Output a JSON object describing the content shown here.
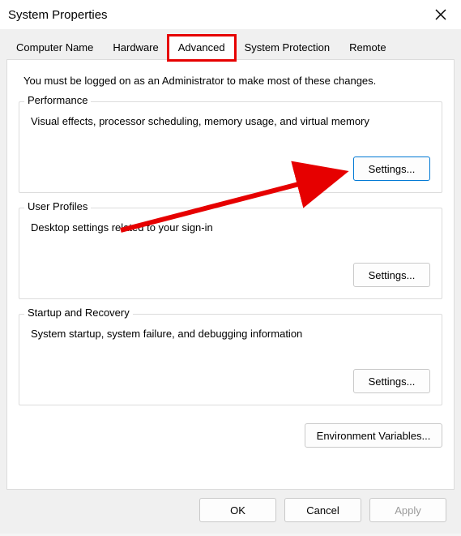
{
  "window": {
    "title": "System Properties"
  },
  "tabs": {
    "items": [
      {
        "label": "Computer Name"
      },
      {
        "label": "Hardware"
      },
      {
        "label": "Advanced"
      },
      {
        "label": "System Protection"
      },
      {
        "label": "Remote"
      }
    ]
  },
  "content": {
    "intro": "You must be logged on as an Administrator to make most of these changes.",
    "groups": {
      "performance": {
        "legend": "Performance",
        "desc": "Visual effects, processor scheduling, memory usage, and virtual memory",
        "button": "Settings..."
      },
      "userProfiles": {
        "legend": "User Profiles",
        "desc": "Desktop settings related to your sign-in",
        "button": "Settings..."
      },
      "startup": {
        "legend": "Startup and Recovery",
        "desc": "System startup, system failure, and debugging information",
        "button": "Settings..."
      }
    },
    "envButton": "Environment Variables..."
  },
  "footer": {
    "ok": "OK",
    "cancel": "Cancel",
    "apply": "Apply"
  }
}
